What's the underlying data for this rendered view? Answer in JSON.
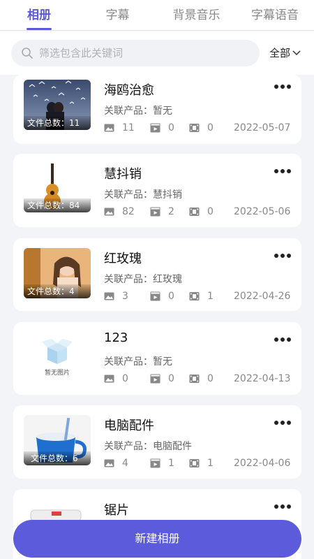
{
  "tabs": [
    {
      "label": "相册"
    },
    {
      "label": "字幕"
    },
    {
      "label": "背景音乐"
    },
    {
      "label": "字幕语音"
    }
  ],
  "search": {
    "placeholder": "筛选包含此关键词"
  },
  "filter": {
    "label": "全部"
  },
  "albums": [
    {
      "title": "海鸥治愈",
      "product": "关联产品：暂无",
      "thumb_label": "文件总数：11",
      "images": "11",
      "videos": "0",
      "clips": "0",
      "date": "2022-05-07"
    },
    {
      "title": "慧抖销",
      "product": "关联产品：慧抖销",
      "thumb_label": "文件总数：84",
      "images": "82",
      "videos": "2",
      "clips": "0",
      "date": "2022-05-06"
    },
    {
      "title": "红玫瑰",
      "product": "关联产品：红玫瑰",
      "thumb_label": "文件总数：4",
      "images": "3",
      "videos": "0",
      "clips": "1",
      "date": "2022-04-26"
    },
    {
      "title": "123",
      "product": "关联产品：暂无",
      "thumb_label": "暂无图片",
      "images": "0",
      "videos": "0",
      "clips": "0",
      "date": "2022-04-13"
    },
    {
      "title": "电脑配件",
      "product": "关联产品：电脑配件",
      "thumb_label": "文件总数：6",
      "images": "4",
      "videos": "1",
      "clips": "1",
      "date": "2022-04-06"
    },
    {
      "title": "锯片"
    }
  ],
  "new_button": {
    "label": "新建相册"
  },
  "colors": {
    "accent": "#5b5bdc",
    "background": "#f3f4f7"
  }
}
